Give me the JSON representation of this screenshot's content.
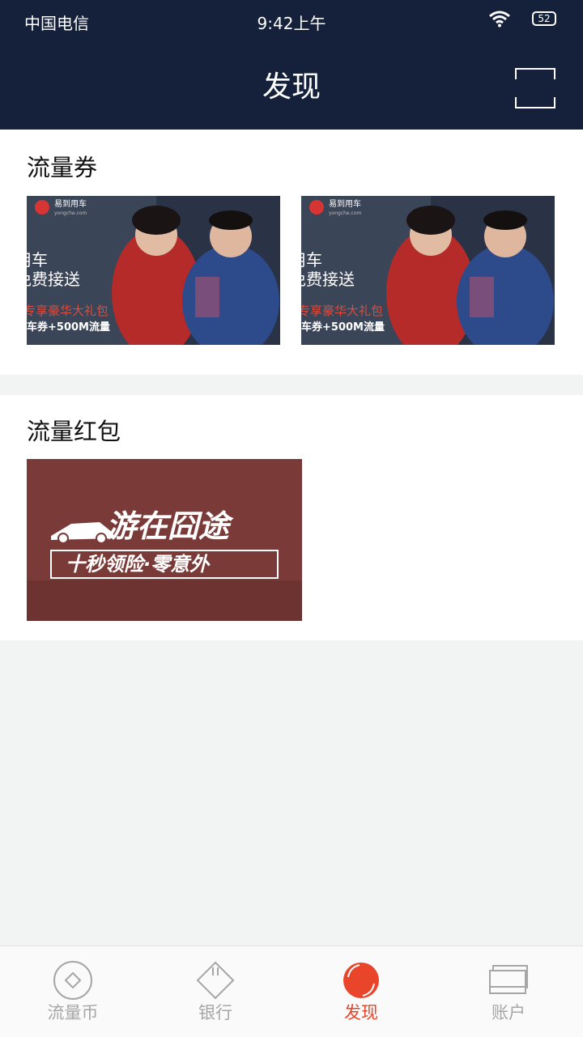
{
  "status_bar": {
    "carrier": "中国电信",
    "time": "9:42上午",
    "battery": "52"
  },
  "header": {
    "title": "发现"
  },
  "sections": [
    {
      "title": "流量券",
      "cards": [
        {
          "brand": "易到用车",
          "brand_sub": "yongche.com",
          "line1": "用车",
          "line2": "免费接送",
          "line3": "专享豪华大礼包",
          "line4": "车券+500M流量"
        },
        {
          "brand": "易到用车",
          "brand_sub": "yongche.com",
          "line1": "用车",
          "line2": "免费接送",
          "line3": "专享豪华大礼包",
          "line4": "车券+500M流量"
        }
      ]
    },
    {
      "title": "流量红包",
      "cards": [
        {
          "line1": "游在囧途",
          "line2": "十秒领险·零意外"
        }
      ]
    }
  ],
  "tabs": [
    {
      "label": "流量币",
      "icon": "coin-icon"
    },
    {
      "label": "银行",
      "icon": "bank-icon"
    },
    {
      "label": "发现",
      "icon": "discover-icon",
      "active": true
    },
    {
      "label": "账户",
      "icon": "account-icon"
    }
  ],
  "colors": {
    "header_bg": "#15203a",
    "accent": "#e8452a",
    "tab_inactive": "#a6a6a6",
    "page_bg": "#f2f3f3",
    "red_banner": "#7a3a38"
  }
}
